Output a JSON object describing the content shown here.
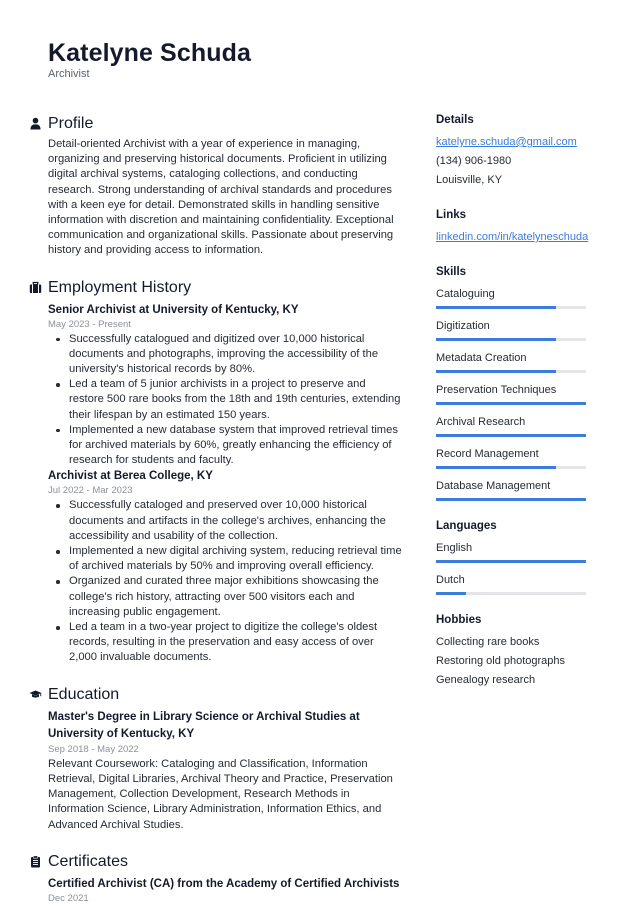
{
  "header": {
    "name": "Katelyne Schuda",
    "title": "Archivist"
  },
  "profile": {
    "heading": "Profile",
    "icon": "person-icon",
    "text": "Detail-oriented Archivist with a year of experience in managing, organizing and preserving historical documents. Proficient in utilizing digital archival systems, cataloging collections, and conducting research. Strong understanding of archival standards and procedures with a keen eye for detail. Demonstrated skills in handling sensitive information with discretion and maintaining confidentiality. Exceptional communication and organizational skills. Passionate about preserving history and providing access to information."
  },
  "employment": {
    "heading": "Employment History",
    "icon": "briefcase-icon",
    "jobs": [
      {
        "title": "Senior Archivist at University of Kentucky, KY",
        "dates": "May 2023 - Present",
        "bullets": [
          "Successfully catalogued and digitized over 10,000 historical documents and photographs, improving the accessibility of the university's historical records by 80%.",
          "Led a team of 5 junior archivists in a project to preserve and restore 500 rare books from the 18th and 19th centuries, extending their lifespan by an estimated 150 years.",
          "Implemented a new database system that improved retrieval times for archived materials by 60%, greatly enhancing the efficiency of research for students and faculty."
        ]
      },
      {
        "title": "Archivist at Berea College, KY",
        "dates": "Jul 2022 - Mar 2023",
        "bullets": [
          "Successfully cataloged and preserved over 10,000 historical documents and artifacts in the college's archives, enhancing the accessibility and usability of the collection.",
          "Implemented a new digital archiving system, reducing retrieval time of archived materials by 50% and improving overall efficiency.",
          "Organized and curated three major exhibitions showcasing the college's rich history, attracting over 500 visitors each and increasing public engagement.",
          "Led a team in a two-year project to digitize the college's oldest records, resulting in the preservation and easy access of over 2,000 invaluable documents."
        ]
      }
    ]
  },
  "education": {
    "heading": "Education",
    "icon": "graduation-cap-icon",
    "items": [
      {
        "title": "Master's Degree in Library Science or Archival Studies at University of Kentucky, KY",
        "dates": "Sep 2018 - May 2022",
        "description": "Relevant Coursework: Cataloging and Classification, Information Retrieval, Digital Libraries, Archival Theory and Practice, Preservation Management, Collection Development, Research Methods in Information Science, Library Administration, Information Ethics, and Advanced Archival Studies."
      }
    ]
  },
  "certificates": {
    "heading": "Certificates",
    "icon": "clipboard-icon",
    "items": [
      {
        "title": "Certified Archivist (CA) from the Academy of Certified Archivists",
        "date": "Dec 2021"
      }
    ]
  },
  "details": {
    "heading": "Details",
    "email": "katelyne.schuda@gmail.com",
    "phone": "(134) 906-1980",
    "location": "Louisville, KY"
  },
  "links": {
    "heading": "Links",
    "items": [
      "linkedin.com/in/katelyneschuda"
    ]
  },
  "skills": {
    "heading": "Skills",
    "items": [
      {
        "name": "Cataloguing",
        "level": 0.8
      },
      {
        "name": "Digitization",
        "level": 0.8
      },
      {
        "name": "Metadata Creation",
        "level": 0.8
      },
      {
        "name": "Preservation Techniques",
        "level": 1.0
      },
      {
        "name": "Archival Research",
        "level": 1.0
      },
      {
        "name": "Record Management",
        "level": 0.8
      },
      {
        "name": "Database Management",
        "level": 1.0
      }
    ]
  },
  "languages": {
    "heading": "Languages",
    "items": [
      {
        "name": "English",
        "level": 1.0
      },
      {
        "name": "Dutch",
        "level": 0.2
      }
    ]
  },
  "hobbies": {
    "heading": "Hobbies",
    "items": [
      "Collecting rare books",
      "Restoring old photographs",
      "Genealogy research"
    ]
  },
  "colors": {
    "accent": "#3b7ddd",
    "track": "#e3e5e8",
    "text": "#141a2c",
    "muted": "#8c909a"
  }
}
